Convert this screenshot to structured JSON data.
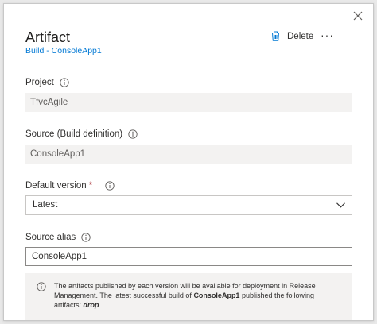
{
  "panel": {
    "title": "Artifact",
    "subtitle": "Build - ConsoleApp1",
    "delete_label": "Delete",
    "more_label": "···"
  },
  "fields": {
    "project": {
      "label": "Project",
      "value": "TfvcAgile"
    },
    "source": {
      "label": "Source (Build definition)",
      "value": "ConsoleApp1"
    },
    "default_version": {
      "label": "Default version",
      "required_mark": "*",
      "value": "Latest"
    },
    "source_alias": {
      "label": "Source alias",
      "value": "ConsoleApp1"
    }
  },
  "message": {
    "text_1": "The artifacts published by each version will be available for deployment in Release Management. The latest successful build of ",
    "build_name": "ConsoleApp1",
    "text_2": "  published the following artifacts: ",
    "artifact": "drop",
    "text_3": "."
  },
  "icons": {
    "close": "close-icon",
    "delete": "trash-icon",
    "info": "info-icon",
    "dropdown": "chevron-down-icon"
  },
  "colors": {
    "link": "#0078d4",
    "required": "#a4262c",
    "readonly_bg": "#f3f2f1"
  }
}
